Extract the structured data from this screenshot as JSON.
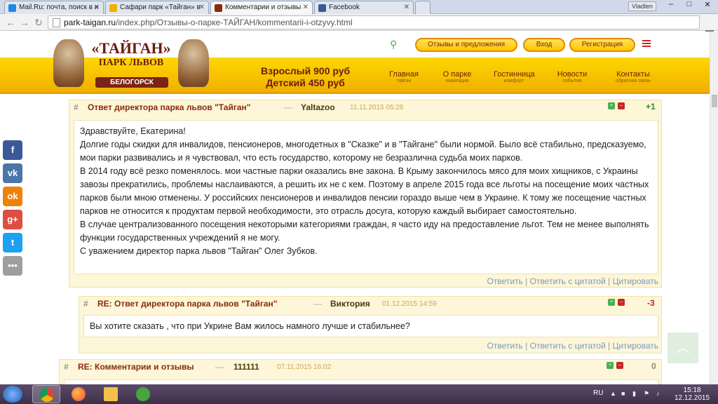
{
  "browser": {
    "tabs": [
      {
        "title": "Mail.Ru: почта, поиск в и",
        "favicon_color": "#1e88e5",
        "active": false
      },
      {
        "title": "Сафари парк «Тайган» в",
        "favicon_color": "#f0b000",
        "active": false
      },
      {
        "title": "Комментарии и отзывы",
        "favicon_color": "#8a2a10",
        "active": true
      },
      {
        "title": "Facebook",
        "favicon_color": "#3b5998",
        "active": false
      }
    ],
    "user": "Vladlen",
    "url_host": "park-taigan.ru",
    "url_path": "/index.php/Отзывы-о-парке-ТАЙГАН/kommentarii-i-otzyvy.html",
    "back_icon": "arrow-left-icon",
    "forward_icon": "arrow-right-icon",
    "reload_icon": "reload-icon"
  },
  "site": {
    "logo_title": "«ТАЙГАН»",
    "logo_sub": "ПАРК ЛЬВОВ",
    "logo_city": "БЕЛОГОРСК",
    "price_adult": "Взрослый 900 руб",
    "price_child": "Детский 450 руб",
    "btn_reviews": "Отзывы и предложения",
    "btn_login": "Вход",
    "btn_register": "Регистрация",
    "nav": [
      {
        "main": "Главная",
        "sub": "тайган"
      },
      {
        "main": "О парке",
        "sub": "навигация"
      },
      {
        "main": "Гостинница",
        "sub": "комфорт"
      },
      {
        "main": "Новости",
        "sub": "события"
      },
      {
        "main": "Контакты",
        "sub": "обратная связь"
      }
    ],
    "accent_color": "#ffd700",
    "brand_color": "#6b1d10"
  },
  "social": [
    {
      "name": "facebook-icon",
      "label": "f",
      "color": "#3b5998"
    },
    {
      "name": "vk-icon",
      "label": "vk",
      "color": "#4a76a8"
    },
    {
      "name": "odnoklassniki-icon",
      "label": "ok",
      "color": "#ee8208"
    },
    {
      "name": "googleplus-icon",
      "label": "g+",
      "color": "#dc4e41"
    },
    {
      "name": "twitter-icon",
      "label": "t",
      "color": "#1da1f2"
    },
    {
      "name": "more-icon",
      "label": "•••",
      "color": "#9e9e9e"
    }
  ],
  "comments": [
    {
      "hash": "#",
      "title": "Ответ директора парка львов \"Тайган\"",
      "dash": "—",
      "author": "Yaltazoo",
      "date": "11.11.2015 05:28",
      "score": "+1",
      "score_color": "#2e8b2e",
      "body": [
        "Здравствуйте, Екатерина!",
        "Долгие годы скидки для инвалидов, пенсионеров, многодетных в \"Сказке\" и в \"Тайгане\" были нормой. Было всё стабильно, предсказуемо, мои парки развивались и я чувствовал, что есть государство, которому не безразлична судьба моих парков.",
        "В 2014 году всё резко поменялось. мои частные парки оказались вне закона. В Крыму закончилось мясо для моих хищников, с Украины завозы прекратились, проблемы наслаиваются, а решить их не с кем. Поэтому в апреле 2015 года все льготы на посещение моих частных парков были мною отменены. У российских пенсионеров и инвалидов пенсии гораздо выше чем в Украине. К тому же посещение частных парков не относится к продуктам первой необходимости, это отрасль досуга, которую каждый выбирает самостоятельно.",
        "В случае централизованного посещения некоторыми категориями граждан, я часто иду на предоставление льгот. Тем не менее выполнять функции государственных учреждений я не могу.",
        "С уважением директор парка львов \"Тайган\" Олег Зубков."
      ]
    },
    {
      "hash": "#",
      "title": "RE: Ответ директора парка львов \"Тайган\"",
      "dash": "—",
      "author": "Виктория",
      "date": "01.12.2015 14:59",
      "score": "-3",
      "score_color": "#c62828",
      "body": [
        "Вы хотите сказать , что при Укрине Вам жилось намного лучше и стабильнее?"
      ]
    },
    {
      "hash": "#",
      "title": "RE: Комментарии и отзывы",
      "dash": "—",
      "author": "111111",
      "date": "07.11.2015 16:02",
      "score": "0",
      "score_color": "#888888",
      "body": []
    }
  ],
  "actions": {
    "reply": "Ответить",
    "reply_quote": "Ответить с цитатой",
    "quote": "Цитировать",
    "sep": "|"
  },
  "taskbar": {
    "lang": "RU",
    "time": "15:18",
    "date": "12.12.2015",
    "apps": [
      {
        "name": "chrome-icon",
        "color": "#db4437",
        "active": true
      },
      {
        "name": "firefox-icon",
        "color": "#ff7139",
        "active": false
      },
      {
        "name": "explorer-folder-icon",
        "color": "#f3c04a",
        "active": false
      },
      {
        "name": "utorrent-icon",
        "color": "#48a43f",
        "active": false
      }
    ]
  }
}
